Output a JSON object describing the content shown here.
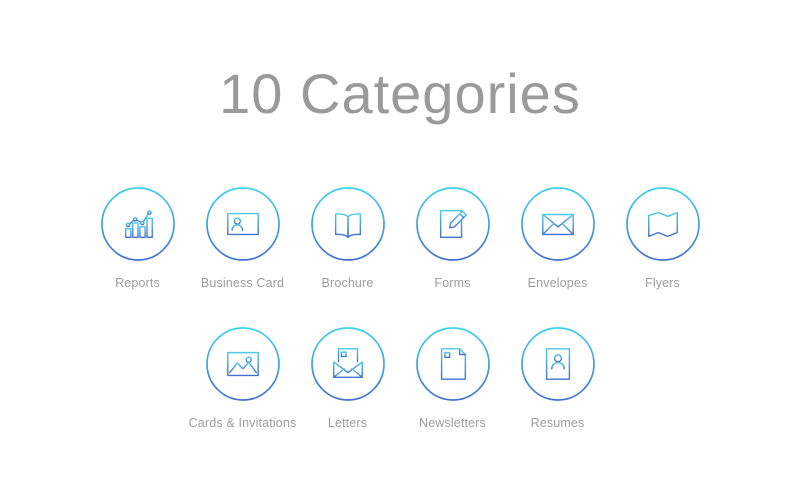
{
  "page": {
    "title": "10 Categories",
    "background_color": "#ffffff",
    "title_color": "#9a9a9a",
    "label_color": "#9d9d9d"
  },
  "theme": {
    "ring_gradient_top": "#3FD2EA",
    "ring_gradient_bottom": "#4472D0",
    "icon_gradient_top": "#4CC9E8",
    "icon_gradient_bottom": "#4472D0"
  },
  "rows": [
    {
      "items": [
        {
          "label": "Reports",
          "icon": "bar-chart-line-icon"
        },
        {
          "label": "Business Card",
          "icon": "id-card-icon"
        },
        {
          "label": "Brochure",
          "icon": "open-book-icon"
        },
        {
          "label": "Forms",
          "icon": "document-pencil-icon"
        },
        {
          "label": "Envelopes",
          "icon": "envelope-icon"
        },
        {
          "label": "Flyers",
          "icon": "folded-map-icon"
        }
      ]
    },
    {
      "items": [
        {
          "label": "Cards & Invitations",
          "icon": "picture-frame-icon"
        },
        {
          "label": "Letters",
          "icon": "open-envelope-letter-icon"
        },
        {
          "label": "Newsletters",
          "icon": "document-lines-icon"
        },
        {
          "label": "Resumes",
          "icon": "resume-person-icon"
        }
      ]
    }
  ]
}
